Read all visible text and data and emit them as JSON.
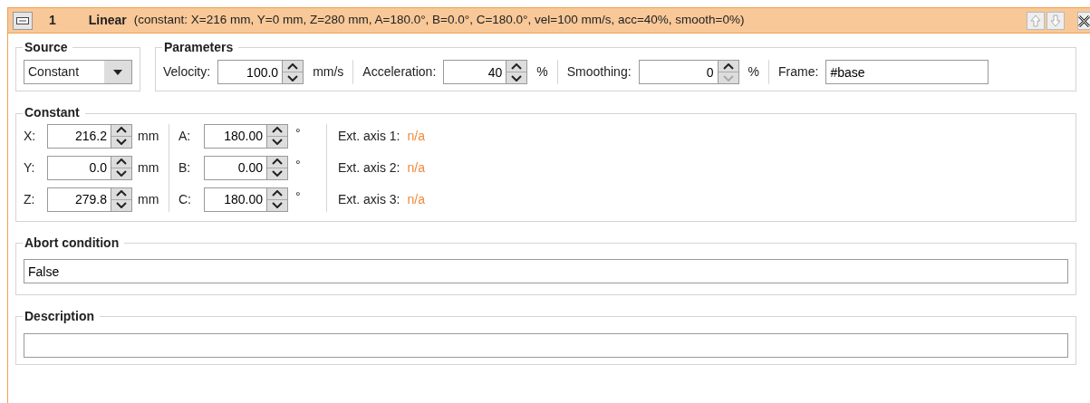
{
  "header": {
    "collapsed": false,
    "number": "1",
    "title": "Linear",
    "summary": "(constant: X=216 mm, Y=0 mm, Z=280 mm, A=180.0°, B=0.0°, C=180.0°, vel=100 mm/s, acc=40%, smooth=0%)",
    "move_up": {
      "disabled": true
    },
    "move_down": {
      "disabled": true
    }
  },
  "source": {
    "label": "Source",
    "value": "Constant"
  },
  "parameters": {
    "label": "Parameters",
    "fields": [
      {
        "kind": "spin",
        "label": "Velocity:",
        "value": "100.0",
        "unit": "mm/s",
        "down_disabled": false
      },
      {
        "kind": "spin",
        "label": "Acceleration:",
        "value": "40",
        "unit": "%",
        "down_disabled": false
      },
      {
        "kind": "spin",
        "label": "Smoothing:",
        "value": "0",
        "unit": "%",
        "down_disabled": true
      },
      {
        "kind": "text",
        "label": "Frame:",
        "value": "#base"
      }
    ]
  },
  "constant": {
    "label": "Constant",
    "columns": [
      [
        {
          "label": "X:",
          "value": "216.2",
          "unit": "mm"
        },
        {
          "label": "Y:",
          "value": "0.0",
          "unit": "mm"
        },
        {
          "label": "Z:",
          "value": "279.8",
          "unit": "mm"
        }
      ],
      [
        {
          "label": "A:",
          "value": "180.00",
          "unit": "°"
        },
        {
          "label": "B:",
          "value": "0.00",
          "unit": "°"
        },
        {
          "label": "C:",
          "value": "180.00",
          "unit": "°"
        }
      ]
    ],
    "ext_axes": [
      {
        "label": "Ext. axis 1:",
        "value": "n/a"
      },
      {
        "label": "Ext. axis 2:",
        "value": "n/a"
      },
      {
        "label": "Ext. axis 3:",
        "value": "n/a"
      }
    ]
  },
  "abort": {
    "label": "Abort condition",
    "value": "False"
  },
  "description": {
    "label": "Description"
  }
}
